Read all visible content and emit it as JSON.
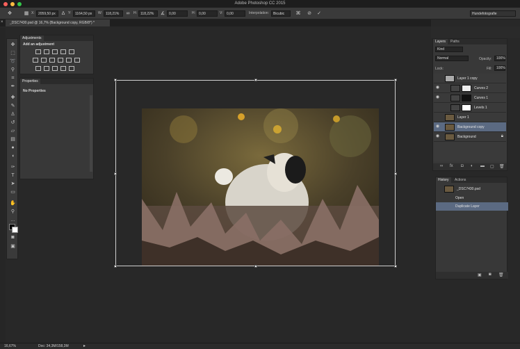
{
  "app": {
    "title": "Adobe Photoshop CC 2015",
    "workspace": "Hundefotografie"
  },
  "options_bar": {
    "x_label": "X:",
    "x_value": "2059,50 px",
    "y_label": "Y:",
    "y_value": "1164,50 px",
    "w_label": "W:",
    "w_value": "118,21%",
    "h_label": "H:",
    "h_value": "118,22%",
    "angle_value": "0,00",
    "hskew_label": "H:",
    "hskew_value": "0,00",
    "vskew_label": "V:",
    "vskew_value": "0,00",
    "interp_label": "Interpolation:",
    "interp_value": "Bicubic"
  },
  "document": {
    "tab_label": "_DSC7430.psd @ 16,7% (Background copy, RGB/8*) *"
  },
  "adjustments": {
    "tab": "Adjustments",
    "heading": "Add an adjustment"
  },
  "properties": {
    "tab": "Properties",
    "text": "No Properties"
  },
  "layers": {
    "tabs": [
      "Layers",
      "Paths"
    ],
    "filter_kind": "Kind",
    "blend_mode": "Normal",
    "opacity_label": "Opacity:",
    "opacity_value": "100%",
    "lock_label": "Lock:",
    "fill_label": "Fill:",
    "fill_value": "100%",
    "items": [
      {
        "name": "Layer 1 copy"
      },
      {
        "name": "Curves 2"
      },
      {
        "name": "Curves 1"
      },
      {
        "name": "Levels 1"
      },
      {
        "name": "Layer 1"
      },
      {
        "name": "Background copy"
      },
      {
        "name": "Background"
      }
    ]
  },
  "history": {
    "tabs": [
      "History",
      "Actions"
    ],
    "snapshot": "_DSC7430.psd",
    "items": [
      {
        "name": "Open"
      },
      {
        "name": "Duplicate Layer"
      }
    ]
  },
  "status": {
    "zoom": "16,67%",
    "doc": "Doc: 34,3M/158,3M"
  }
}
